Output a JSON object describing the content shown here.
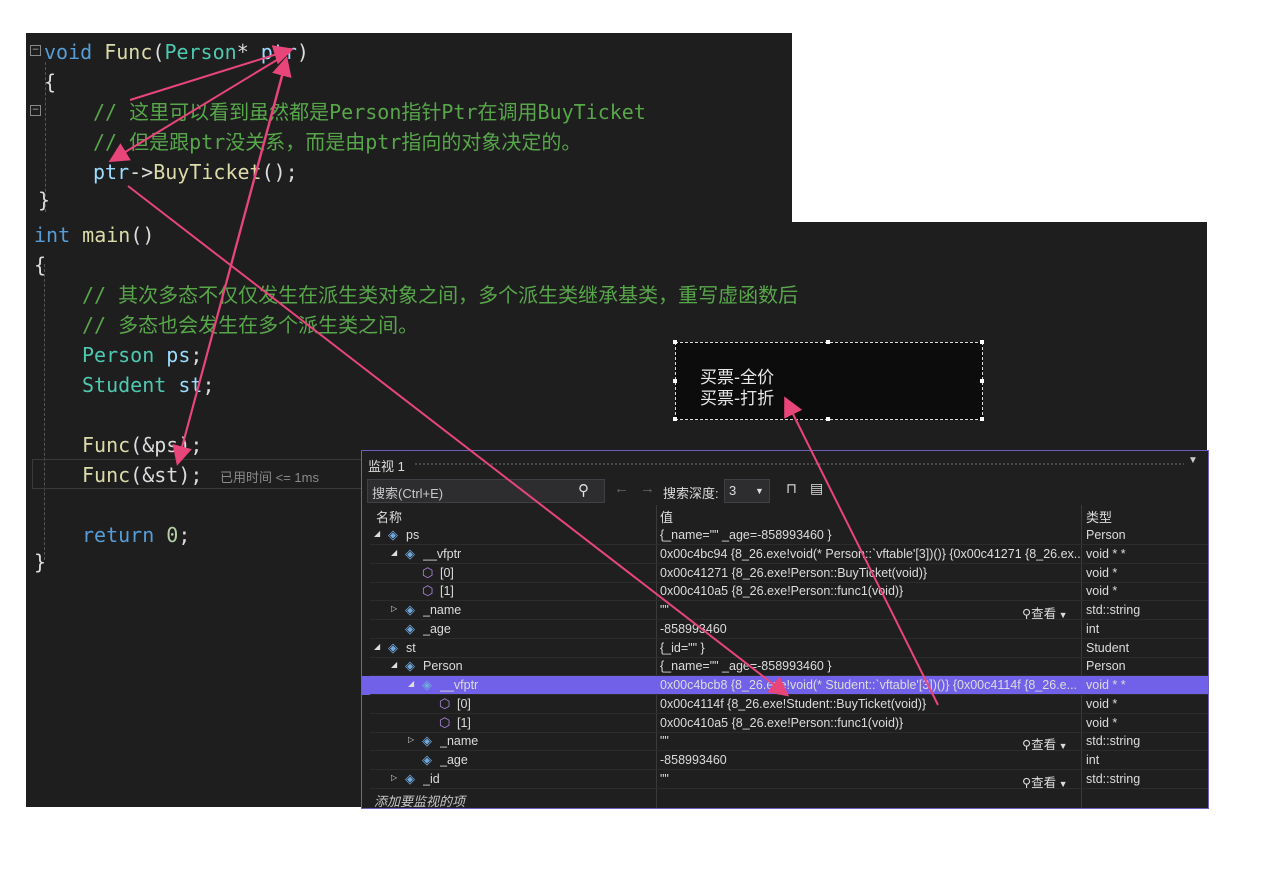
{
  "code_top": {
    "line1": {
      "kw": "void",
      "fn": "Func",
      "open": "(",
      "type": "Person",
      "star": "*",
      "param": "ptr",
      "close": ")"
    },
    "line2": "{",
    "comment1": "// 这里可以看到虽然都是Person指针Ptr在调用BuyTicket",
    "comment2": "// 但是跟ptr没关系，而是由ptr指向的对象决定的。",
    "call_obj": "ptr",
    "call_arrow": "->",
    "call_fn": "BuyTicket",
    "call_tail": "();",
    "close": "}"
  },
  "code_bottom": {
    "main_kw": "int",
    "main_fn": "main",
    "main_paren": "()",
    "open": "{",
    "comment1": "// 其次多态不仅仅发生在派生类对象之间，多个派生类继承基类，重写虚函数后",
    "comment2": "// 多态也会发生在多个派生类之间。",
    "decl1_type": "Person",
    "decl1_var": "ps",
    "decl2_type": "Student",
    "decl2_var": "st",
    "semi": ";",
    "call1_fn": "Func",
    "call1_args": "(&ps)",
    "call2_fn": "Func",
    "call2_args": "(&st)",
    "elapsed": "已用时间 <= 1ms",
    "ret_kw": "return",
    "ret_val": "0",
    "close": "}"
  },
  "console": {
    "line1": "买票-全价",
    "line2": "买票-打折"
  },
  "watch": {
    "title": "监视 1",
    "search_placeholder": "搜索(Ctrl+E)",
    "depth_label": "搜索深度:",
    "depth_value": "3",
    "col_name": "名称",
    "col_value": "值",
    "col_type": "类型",
    "view_label": "查看",
    "add_item": "添加要监视的项",
    "rows": [
      {
        "name": "ps",
        "value": "{_name=\"\" _age=-858993460 }",
        "type": "Person"
      },
      {
        "name": "__vfptr",
        "value": "0x00c4bc94 {8_26.exe!void(* Person::`vftable'[3])()} {0x00c41271 {8_26.ex...",
        "type": "void * *"
      },
      {
        "name": "[0]",
        "value": "0x00c41271 {8_26.exe!Person::BuyTicket(void)}",
        "type": "void *"
      },
      {
        "name": "[1]",
        "value": "0x00c410a5 {8_26.exe!Person::func1(void)}",
        "type": "void *"
      },
      {
        "name": "_name",
        "value": "\"\"",
        "type": "std::string"
      },
      {
        "name": "_age",
        "value": "-858993460",
        "type": "int"
      },
      {
        "name": "st",
        "value": "{_id=\"\" }",
        "type": "Student"
      },
      {
        "name": "Person",
        "value": "{_name=\"\" _age=-858993460 }",
        "type": "Person"
      },
      {
        "name": "__vfptr",
        "value": "0x00c4bcb8 {8_26.exe!void(* Student::`vftable'[3])()} {0x00c4114f {8_26.e...",
        "type": "void * *"
      },
      {
        "name": "[0]",
        "value": "0x00c4114f {8_26.exe!Student::BuyTicket(void)}",
        "type": "void *"
      },
      {
        "name": "[1]",
        "value": "0x00c410a5 {8_26.exe!Person::func1(void)}",
        "type": "void *"
      },
      {
        "name": "_name",
        "value": "\"\"",
        "type": "std::string"
      },
      {
        "name": "_age",
        "value": "-858993460",
        "type": "int"
      },
      {
        "name": "_id",
        "value": "\"\"",
        "type": "std::string"
      }
    ]
  },
  "colors": {
    "editor_bg": "#1e1e1e",
    "keyword": "#569cd6",
    "type": "#4ec9b0",
    "function": "#dcdcaa",
    "comment": "#57a64a",
    "selection": "#7160e8",
    "annotation_arrow": "#e8457a"
  }
}
